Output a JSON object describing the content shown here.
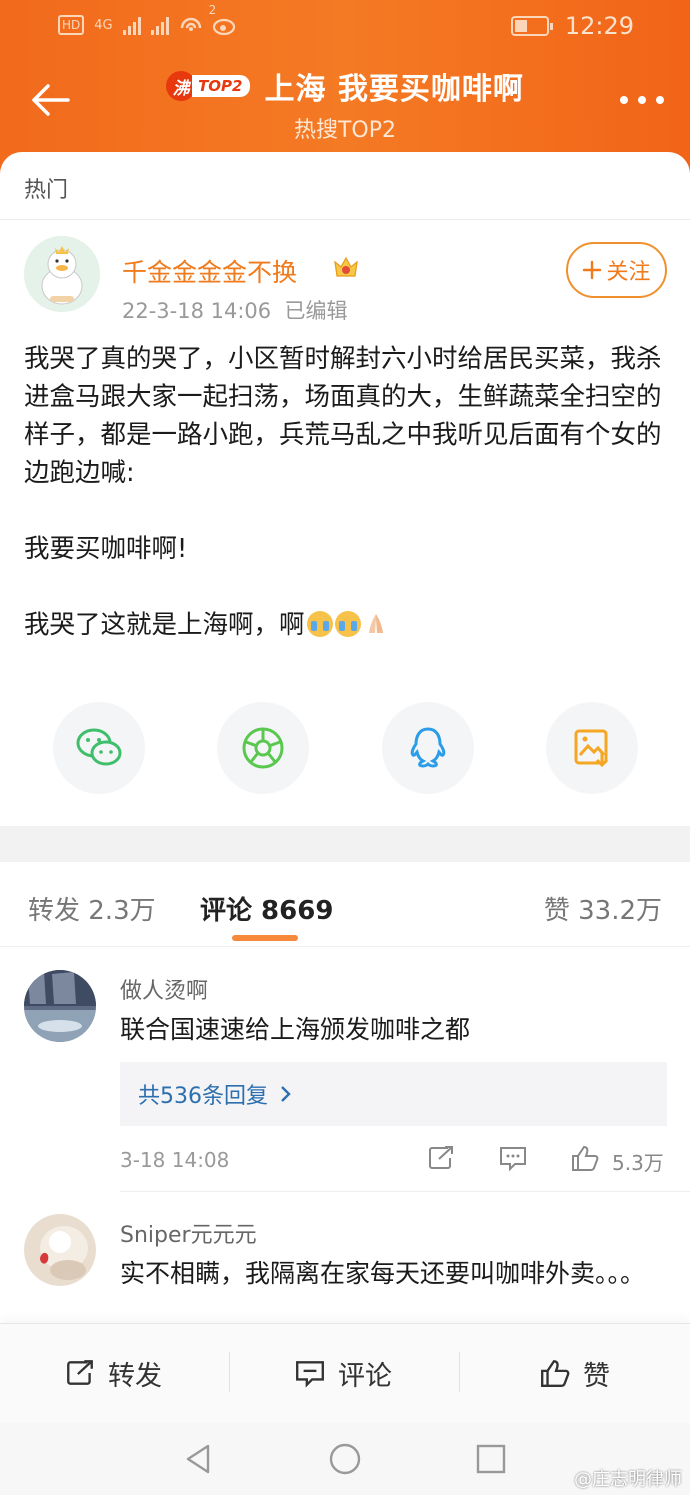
{
  "status_bar": {
    "hd": "HD",
    "net": "4G",
    "time": "12:29",
    "weibo_badge": "2"
  },
  "header": {
    "badge_icon": "沸",
    "badge_label": "TOP2",
    "title": "上海 我要买咖啡啊",
    "subtitle": "热搜TOP2"
  },
  "sort_tab": "热门",
  "post": {
    "username": "千金金金金不换",
    "meta": "22-3-18 14:06  已编辑",
    "follow_label": "关注",
    "paragraphs": [
      "我哭了真的哭了，小区暂时解封六小时给居民买菜，我杀进盒马跟大家一起扫荡，场面真的大，生鲜蔬菜全扫空的样子，都是一路小跑，兵荒马乱之中我听见后面有个女的边跑边喊:",
      "我要买咖啡啊!",
      "我哭了这就是上海啊，啊"
    ],
    "share_targets": [
      "wechat-icon",
      "moments-icon",
      "qq-icon",
      "save-image-icon"
    ]
  },
  "tabs": {
    "repost": "转发 2.3万",
    "comments": "评论 8669",
    "likes": "赞 33.2万"
  },
  "comments": [
    {
      "name": "做人烫啊",
      "text": "联合国速速给上海颁发咖啡之都",
      "replies": "共536条回复",
      "time": "3-18 14:08",
      "likes": "5.3万"
    },
    {
      "name": "Sniper元元元",
      "text": "实不相瞒，我隔离在家每天还要叫咖啡外卖。。。"
    }
  ],
  "bottom_bar": {
    "repost": "转发",
    "comment": "评论",
    "like": "赞"
  },
  "watermark": "@庄志明律师",
  "colors": {
    "accent": "#f26a1c",
    "link": "#2d6fae",
    "username": "#f07b1d"
  }
}
